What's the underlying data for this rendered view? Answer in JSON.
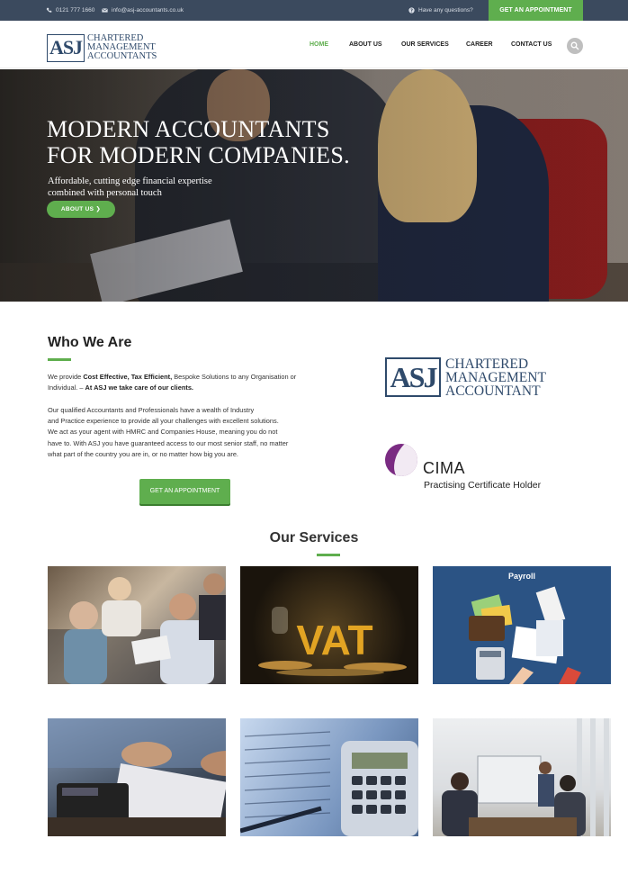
{
  "topbar": {
    "phone": "0121 777 1660",
    "email": "info@asj-accountants.co.uk",
    "questions": "Have any questions?",
    "appointment_label": "GET AN APPOINTMENT"
  },
  "header": {
    "logo_mark": "ASJ",
    "logo_lines": [
      "CHARTERED",
      "MANAGEMENT",
      "ACCOUNTANTS"
    ],
    "nav": [
      "HOME",
      "ABOUT US",
      "OUR SERVICES",
      "CAREER",
      "CONTACT US"
    ],
    "active_nav": "HOME"
  },
  "hero": {
    "title_line1": "MODERN ACCOUNTANTS",
    "title_line2": "FOR MODERN COMPANIES.",
    "sub_line1": "Affordable, cutting edge financial expertise",
    "sub_line2": "combined with personal touch",
    "button_label": "ABOUT US ❯"
  },
  "who": {
    "title": "Who We Are",
    "p1_a": "We provide ",
    "p1_b": "Cost Effective, Tax Efficient,",
    "p1_c": " Bespoke Solutions to any Organisation or",
    "p1_d": "Individual. – ",
    "p1_e": "At ASJ we take care of our clients.",
    "p2_lines": [
      "Our qualified Accountants and Professionals have a wealth of Industry",
      "and Practice experience to provide all your challenges with excellent solutions.",
      "We act as your agent with HMRC and Companies House, meaning you do not",
      "have to. With ASJ you have guaranteed access to our most senior staff, no matter",
      "what part of the country you are in, or no matter how big you are."
    ],
    "appointment_label": "GET AN APPOINTMENT"
  },
  "badges": {
    "logo_mark": "ASJ",
    "logo_lines": [
      "CHARTERED",
      "MANAGEMENT",
      "ACCOUNTANT"
    ],
    "cima_name": "CIMA",
    "cima_cert": "Practising Certificate Holder"
  },
  "services": {
    "title": "Our Services",
    "tiles": [
      {
        "label": ""
      },
      {
        "label": "VAT"
      },
      {
        "label": "Payroll"
      },
      {
        "label": ""
      },
      {
        "label": ""
      },
      {
        "label": ""
      }
    ]
  },
  "colors": {
    "accent_green": "#5fae4e",
    "topbar_navy": "#3b4a5e",
    "logo_navy": "#2f4a6b"
  }
}
